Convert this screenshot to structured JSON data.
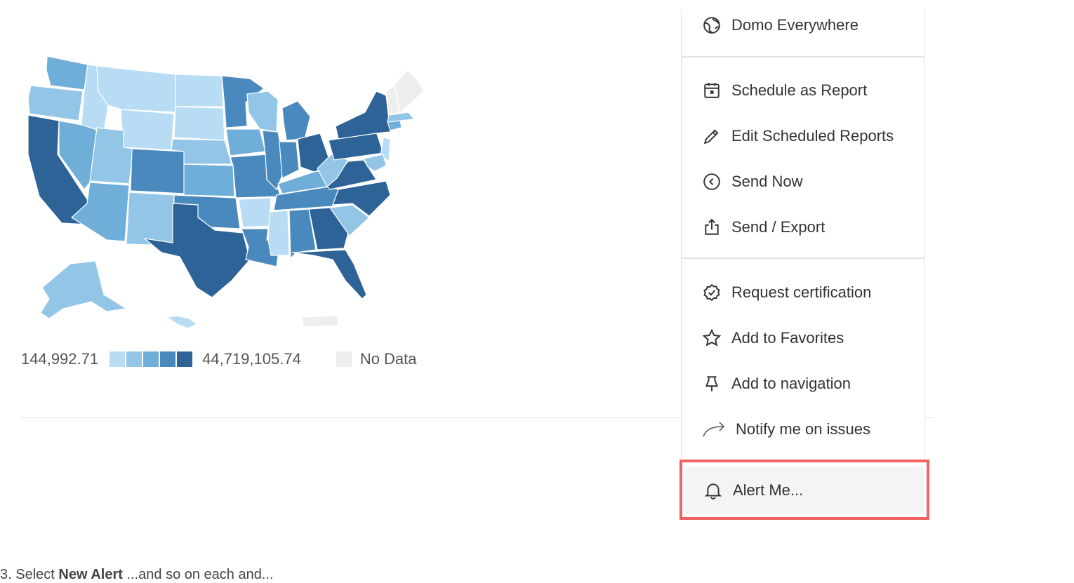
{
  "map": {
    "legend": {
      "min_label": "144,992.71",
      "max_label": "44,719,105.74",
      "no_data_label": "No Data",
      "colors": [
        "#b9dcf5",
        "#93c5e6",
        "#6eaed8",
        "#4a89bd",
        "#2d6396"
      ]
    }
  },
  "menu": {
    "items": [
      {
        "label": "Domo Everywhere",
        "icon": "globe-icon"
      },
      {
        "label": "Schedule as Report",
        "icon": "calendar-icon"
      },
      {
        "label": "Edit Scheduled Reports",
        "icon": "pencil-icon"
      },
      {
        "label": "Send Now",
        "icon": "circle-chevron-left-icon"
      },
      {
        "label": "Send / Export",
        "icon": "share-export-icon"
      },
      {
        "label": "Request certification",
        "icon": "certified-badge-icon"
      },
      {
        "label": "Add to Favorites",
        "icon": "star-icon"
      },
      {
        "label": "Add to navigation",
        "icon": "pin-icon"
      },
      {
        "label": "Notify me on issues",
        "icon": "forward-arrow-icon"
      },
      {
        "label": "Alert Me...",
        "icon": "bell-icon"
      }
    ]
  },
  "caption": {
    "prefix": "3. Select",
    "bold": "New Alert",
    "suffix": "...and so on each and..."
  },
  "colors": {
    "highlight_border": "#f26262",
    "highlight_bg": "#f4f4f4",
    "no_data": "#eeeeee"
  }
}
